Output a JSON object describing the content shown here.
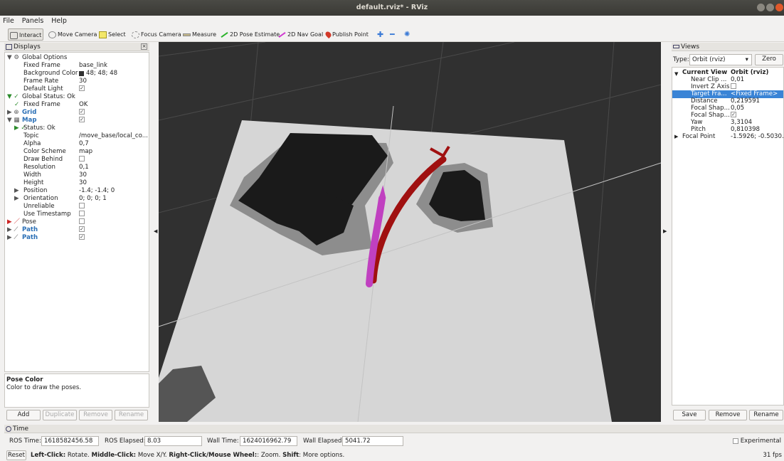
{
  "window": {
    "title": "default.rviz* - RViz"
  },
  "menu": [
    "File",
    "Panels",
    "Help"
  ],
  "toolbar": {
    "tools": [
      "Interact",
      "Move Camera",
      "Select",
      "Focus Camera",
      "Measure",
      "2D Pose Estimate",
      "2D Nav Goal",
      "Publish Point"
    ]
  },
  "displays": {
    "title": "Displays",
    "rows": [
      {
        "label": "Global Options",
        "value": ""
      },
      {
        "label": "Fixed Frame",
        "value": "base_link"
      },
      {
        "label": "Background Color",
        "value": "48; 48; 48"
      },
      {
        "label": "Frame Rate",
        "value": "30"
      },
      {
        "label": "Default Light",
        "value": "✓"
      },
      {
        "label": "Global Status: Ok",
        "value": ""
      },
      {
        "label": "Fixed Frame",
        "value": "OK"
      },
      {
        "label": "Grid",
        "value": "✓"
      },
      {
        "label": "Map",
        "value": "✓"
      },
      {
        "label": "Status: Ok",
        "value": ""
      },
      {
        "label": "Topic",
        "value": "/move_base/local_co..."
      },
      {
        "label": "Alpha",
        "value": "0,7"
      },
      {
        "label": "Color Scheme",
        "value": "map"
      },
      {
        "label": "Draw Behind",
        "value": ""
      },
      {
        "label": "Resolution",
        "value": "0,1"
      },
      {
        "label": "Width",
        "value": "30"
      },
      {
        "label": "Height",
        "value": "30"
      },
      {
        "label": "Position",
        "value": "-1.4; -1.4; 0"
      },
      {
        "label": "Orientation",
        "value": "0; 0; 0; 1"
      },
      {
        "label": "Unreliable",
        "value": ""
      },
      {
        "label": "Use Timestamp",
        "value": ""
      },
      {
        "label": "Pose",
        "value": ""
      },
      {
        "label": "Path",
        "value": "✓"
      },
      {
        "label": "Path",
        "value": "✓"
      }
    ],
    "desc_title": "Pose Color",
    "desc_text": "Color to draw the poses.",
    "buttons": {
      "add": "Add",
      "duplicate": "Duplicate",
      "remove": "Remove",
      "rename": "Rename"
    }
  },
  "views": {
    "title": "Views",
    "type_label": "Type:",
    "type_value": "Orbit (rviz)",
    "zero": "Zero",
    "rows": [
      {
        "label": "Current View",
        "value": "Orbit (rviz)"
      },
      {
        "label": "Near Clip ...",
        "value": "0,01"
      },
      {
        "label": "Invert Z Axis",
        "value": ""
      },
      {
        "label": "Target Fra...",
        "value": "<Fixed Frame>"
      },
      {
        "label": "Distance",
        "value": "0,219591"
      },
      {
        "label": "Focal Shap...",
        "value": "0,05"
      },
      {
        "label": "Focal Shap...",
        "value": "✓"
      },
      {
        "label": "Yaw",
        "value": "3,3104"
      },
      {
        "label": "Pitch",
        "value": "0,810398"
      },
      {
        "label": "Focal Point",
        "value": "-1.5926; -0.5030..."
      }
    ],
    "buttons": {
      "save": "Save",
      "remove": "Remove",
      "rename": "Rename"
    }
  },
  "time": {
    "title": "Time",
    "ros_time_label": "ROS Time:",
    "ros_time": "1618582456.58",
    "ros_elapsed_label": "ROS Elapsed:",
    "ros_elapsed": "8.03",
    "wall_time_label": "Wall Time:",
    "wall_time": "1624016962.79",
    "wall_elapsed_label": "Wall Elapsed:",
    "wall_elapsed": "5041.72",
    "experimental": "Experimental"
  },
  "status": {
    "reset": "Reset",
    "left_bold": "Left-Click:",
    "left_text": " Rotate. ",
    "middle_bold": "Middle-Click:",
    "middle_text": " Move X/Y. ",
    "right_bold": "Right-Click/Mouse Wheel:",
    "right_text": ": Zoom. ",
    "shift_bold": "Shift",
    "shift_text": ": More options.",
    "fps": "31 fps"
  },
  "colors": {
    "background": "#303030",
    "path_red": "#a01010",
    "path_magenta": "#c040c0",
    "selection": "#3a84d6"
  }
}
